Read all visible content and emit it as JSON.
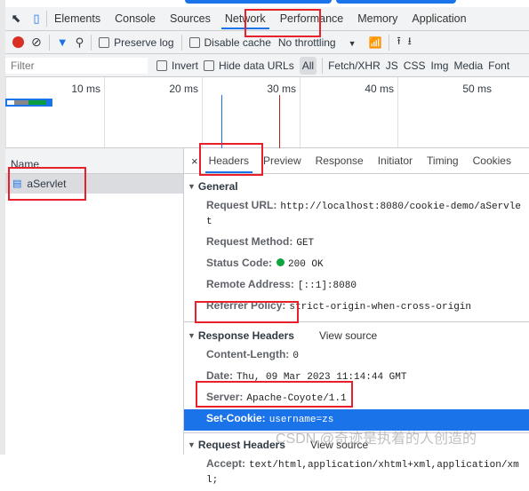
{
  "devtools": {
    "tabs": [
      "Elements",
      "Console",
      "Sources",
      "Network",
      "Performance",
      "Memory",
      "Application"
    ],
    "active_tab": "Network"
  },
  "toolbar": {
    "preserve_log": "Preserve log",
    "disable_cache": "Disable cache",
    "throttling": "No throttling"
  },
  "filter": {
    "placeholder": "Filter",
    "invert": "Invert",
    "hide_data_urls": "Hide data URLs",
    "types": [
      "All",
      "Fetch/XHR",
      "JS",
      "CSS",
      "Img",
      "Media",
      "Font"
    ]
  },
  "timeline": {
    "ticks": [
      "10 ms",
      "20 ms",
      "30 ms",
      "40 ms",
      "50 ms"
    ]
  },
  "requests": {
    "header": "Name",
    "items": [
      "aServlet"
    ]
  },
  "details": {
    "tabs": [
      "Headers",
      "Preview",
      "Response",
      "Initiator",
      "Timing",
      "Cookies"
    ],
    "general": {
      "title": "General",
      "rows": [
        {
          "k": "Request URL:",
          "v": "http://localhost:8080/cookie-demo/aServlet"
        },
        {
          "k": "Request Method:",
          "v": "GET"
        },
        {
          "k": "Status Code:",
          "v": "200 OK"
        },
        {
          "k": "Remote Address:",
          "v": "[::1]:8080"
        },
        {
          "k": "Referrer Policy:",
          "v": "strict-origin-when-cross-origin"
        }
      ]
    },
    "response": {
      "title": "Response Headers",
      "view_source": "View source",
      "rows": [
        {
          "k": "Content-Length:",
          "v": "0"
        },
        {
          "k": "Date:",
          "v": "Thu, 09 Mar 2023 11:14:44 GMT"
        },
        {
          "k": "Server:",
          "v": "Apache-Coyote/1.1"
        },
        {
          "k": "Set-Cookie:",
          "v": "username=zs"
        }
      ]
    },
    "request": {
      "title": "Request Headers",
      "view_source": "View source",
      "rows": [
        {
          "k": "Accept:",
          "v": "text/html,application/xhtml+xml,application/xml;"
        }
      ]
    }
  },
  "watermark": "CSDN @奇迹是执着的人创造的"
}
